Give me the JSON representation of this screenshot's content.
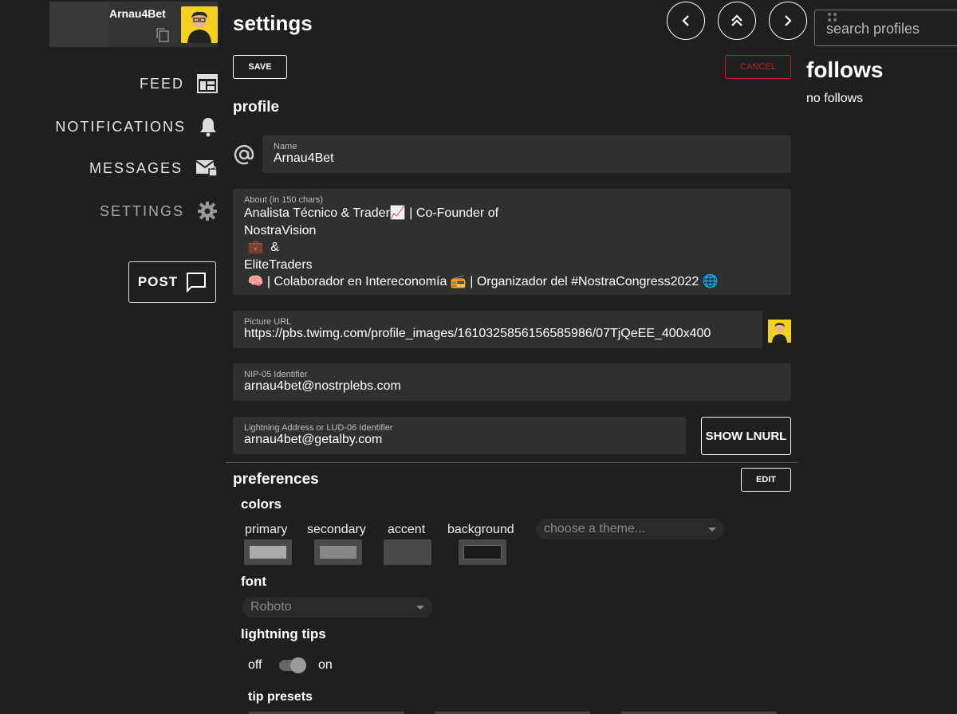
{
  "sidebar": {
    "username": "Arnau4Bet",
    "nav": [
      {
        "label": "FEED",
        "icon": "feed-icon"
      },
      {
        "label": "NOTIFICATIONS",
        "icon": "bell-icon"
      },
      {
        "label": "MESSAGES",
        "icon": "mail-lock-icon"
      },
      {
        "label": "SETTINGS",
        "icon": "gear-icon"
      }
    ],
    "post_label": "POST"
  },
  "header": {
    "title": "settings",
    "nav_buttons": [
      "back-icon",
      "double-up-icon",
      "forward-icon"
    ]
  },
  "actions": {
    "save": "SAVE",
    "cancel": "CANCEL"
  },
  "profile": {
    "title": "profile",
    "name": {
      "label": "Name",
      "value": "Arnau4Bet"
    },
    "about": {
      "label": "About (in 150 chars)",
      "value": "Analista Técnico & Trader📈 | Co-Founder of\nNostraVision\n 💼  &\nEliteTraders\n 🧠 | Colaborador en Intereconomía 📻 | Organizador del #NostraCongress2022 🌐"
    },
    "picture": {
      "label": "Picture URL",
      "value": "https://pbs.twimg.com/profile_images/1610325856156585986/07TjQeEE_400x400"
    },
    "nip05": {
      "label": "NIP-05 Identifier",
      "value": "arnau4bet@nostrplebs.com"
    },
    "lightning": {
      "label": "Lightning Address or LUD-06 Identifier",
      "value": "arnau4bet@getalby.com"
    },
    "show_lnurl": "SHOW LNURL"
  },
  "preferences": {
    "title": "preferences",
    "edit": "EDIT",
    "colors": {
      "title": "colors",
      "labels": [
        "primary",
        "secondary",
        "accent",
        "background"
      ],
      "values": [
        "#aaaaaa",
        "#888888",
        "#4a4a4a",
        "#1a1a1a"
      ],
      "theme_placeholder": "choose a theme..."
    },
    "font": {
      "title": "font",
      "value": "Roboto"
    },
    "lightning_tips": {
      "title": "lightning tips",
      "off": "off",
      "on": "on"
    },
    "tip_presets": {
      "title": "tip presets"
    }
  },
  "right": {
    "search_placeholder": "search profiles",
    "follows_title": "follows",
    "follows_empty": "no follows"
  },
  "colors": {
    "background": "#1f1f1f",
    "panel": "#303030",
    "cancel": "#c62828",
    "avatar_bg": "#f4d21f"
  }
}
